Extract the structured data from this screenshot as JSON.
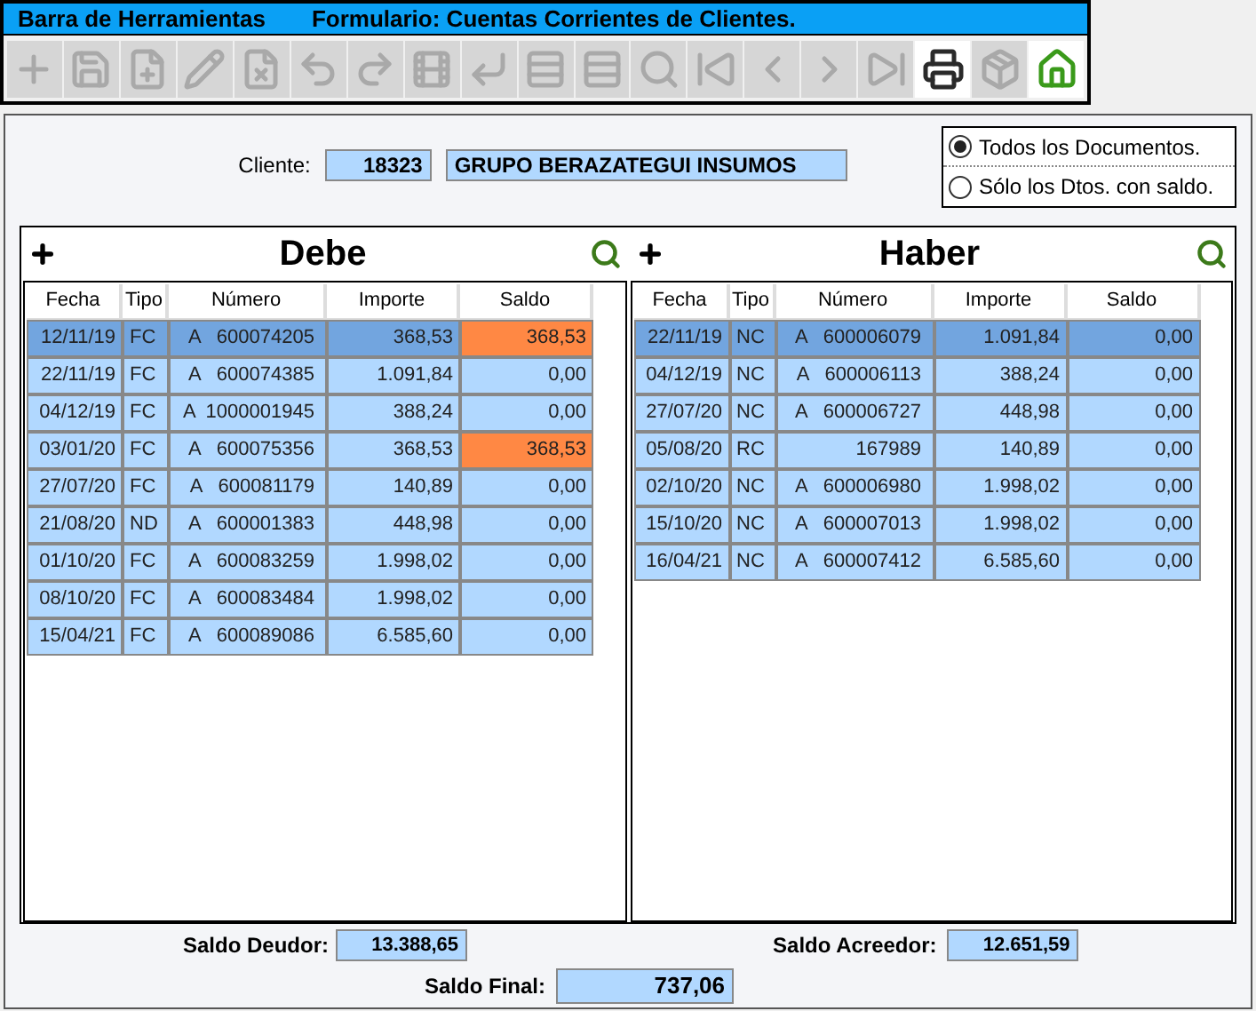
{
  "toolbar": {
    "title": "Barra de Herramientas",
    "form_title": "Formulario: Cuentas Corrientes de Clientes.",
    "buttons": [
      {
        "kind": "add",
        "disabled": true
      },
      {
        "kind": "save",
        "disabled": true
      },
      {
        "kind": "save-add",
        "disabled": true
      },
      {
        "kind": "edit",
        "disabled": true
      },
      {
        "kind": "save-delete",
        "disabled": true
      },
      {
        "kind": "undo",
        "disabled": true
      },
      {
        "kind": "redo",
        "disabled": true
      },
      {
        "kind": "film",
        "disabled": true
      },
      {
        "kind": "enter",
        "disabled": true
      },
      {
        "kind": "list",
        "disabled": true
      },
      {
        "kind": "list",
        "disabled": true
      },
      {
        "kind": "search",
        "disabled": true
      },
      {
        "kind": "first",
        "disabled": true
      },
      {
        "kind": "prev",
        "disabled": true
      },
      {
        "kind": "next",
        "disabled": true
      },
      {
        "kind": "last",
        "disabled": true
      },
      {
        "kind": "print",
        "disabled": false
      },
      {
        "kind": "box",
        "disabled": true
      },
      {
        "kind": "home",
        "disabled": false
      }
    ]
  },
  "cliente": {
    "label": "Cliente:",
    "code": "18323",
    "name": "GRUPO BERAZATEGUI INSUMOS"
  },
  "filter": [
    {
      "label": "Todos los Documentos.",
      "selected": true
    },
    {
      "label": "Sólo los Dtos. con saldo.",
      "selected": false
    }
  ],
  "debe": {
    "title": "Debe",
    "columns": [
      "Fecha",
      "Tipo",
      "Número",
      "Importe",
      "Saldo"
    ],
    "rows": [
      {
        "fecha": "12/11/19",
        "tipo": "FC",
        "numero": "A   600074205",
        "importe": "368,53",
        "saldo": "368,53",
        "selected": true,
        "pending": true
      },
      {
        "fecha": "22/11/19",
        "tipo": "FC",
        "numero": "A   600074385",
        "importe": "1.091,84",
        "saldo": "0,00",
        "selected": false,
        "pending": false
      },
      {
        "fecha": "04/12/19",
        "tipo": "FC",
        "numero": "A  1000001945",
        "importe": "388,24",
        "saldo": "0,00",
        "selected": false,
        "pending": false
      },
      {
        "fecha": "03/01/20",
        "tipo": "FC",
        "numero": "A   600075356",
        "importe": "368,53",
        "saldo": "368,53",
        "selected": false,
        "pending": true
      },
      {
        "fecha": "27/07/20",
        "tipo": "FC",
        "numero": "A   600081179",
        "importe": "140,89",
        "saldo": "0,00",
        "selected": false,
        "pending": false
      },
      {
        "fecha": "21/08/20",
        "tipo": "ND",
        "numero": "A   600001383",
        "importe": "448,98",
        "saldo": "0,00",
        "selected": false,
        "pending": false
      },
      {
        "fecha": "01/10/20",
        "tipo": "FC",
        "numero": "A   600083259",
        "importe": "1.998,02",
        "saldo": "0,00",
        "selected": false,
        "pending": false
      },
      {
        "fecha": "08/10/20",
        "tipo": "FC",
        "numero": "A   600083484",
        "importe": "1.998,02",
        "saldo": "0,00",
        "selected": false,
        "pending": false
      },
      {
        "fecha": "15/04/21",
        "tipo": "FC",
        "numero": "A   600089086",
        "importe": "6.585,60",
        "saldo": "0,00",
        "selected": false,
        "pending": false
      }
    ]
  },
  "haber": {
    "title": "Haber",
    "columns": [
      "Fecha",
      "Tipo",
      "Número",
      "Importe",
      "Saldo"
    ],
    "rows": [
      {
        "fecha": "22/11/19",
        "tipo": "NC",
        "numero": "A   600006079",
        "importe": "1.091,84",
        "saldo": "0,00",
        "selected": true,
        "pending": false
      },
      {
        "fecha": "04/12/19",
        "tipo": "NC",
        "numero": "A   600006113",
        "importe": "388,24",
        "saldo": "0,00",
        "selected": false,
        "pending": false
      },
      {
        "fecha": "27/07/20",
        "tipo": "NC",
        "numero": "A   600006727",
        "importe": "448,98",
        "saldo": "0,00",
        "selected": false,
        "pending": false
      },
      {
        "fecha": "05/08/20",
        "tipo": "RC",
        "numero": "167989",
        "importe": "140,89",
        "saldo": "0,00",
        "selected": false,
        "pending": false
      },
      {
        "fecha": "02/10/20",
        "tipo": "NC",
        "numero": "A   600006980",
        "importe": "1.998,02",
        "saldo": "0,00",
        "selected": false,
        "pending": false
      },
      {
        "fecha": "15/10/20",
        "tipo": "NC",
        "numero": "A   600007013",
        "importe": "1.998,02",
        "saldo": "0,00",
        "selected": false,
        "pending": false
      },
      {
        "fecha": "16/04/21",
        "tipo": "NC",
        "numero": "A   600007412",
        "importe": "6.585,60",
        "saldo": "0,00",
        "selected": false,
        "pending": false
      }
    ]
  },
  "saldo_deudor": {
    "label": "Saldo Deudor:",
    "value": "13.388,65"
  },
  "saldo_acreedor": {
    "label": "Saldo Acreedor:",
    "value": "12.651,59"
  },
  "saldo_final": {
    "label": "Saldo Final:",
    "value": "737,06"
  }
}
